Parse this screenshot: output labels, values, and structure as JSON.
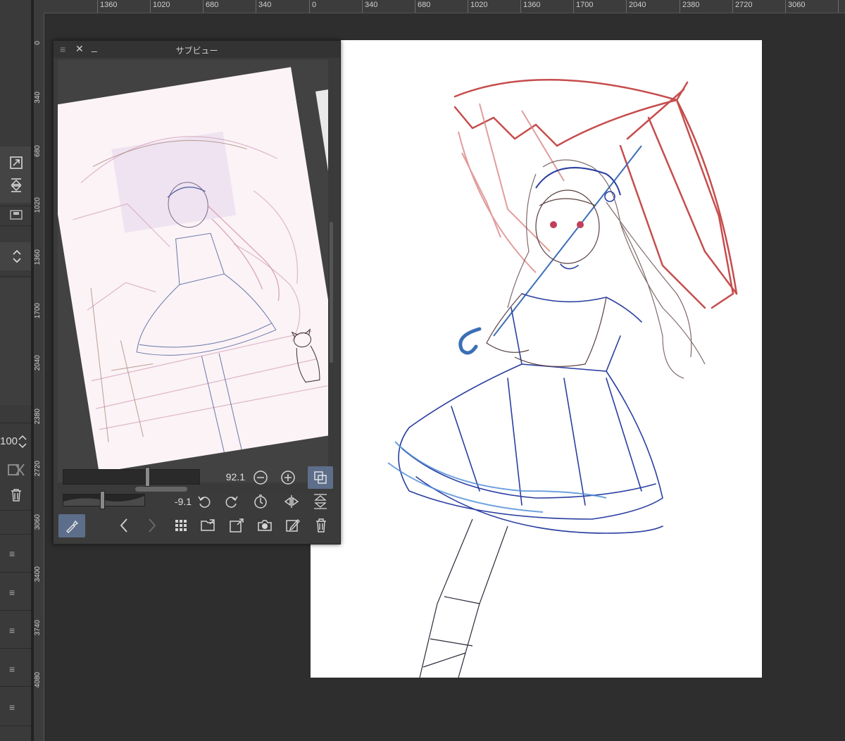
{
  "ruler_top": {
    "labels": [
      "1360",
      "1020",
      "680",
      "340",
      "0",
      "340",
      "680",
      "1020",
      "1360",
      "1700",
      "2040",
      "2380",
      "2720",
      "3060"
    ]
  },
  "ruler_left": {
    "labels": [
      "0",
      "340",
      "680",
      "1020",
      "1360",
      "1700",
      "2040",
      "2380",
      "2720",
      "3060",
      "3400",
      "3740",
      "4080"
    ]
  },
  "left_strip": {
    "value_field": "100"
  },
  "subview": {
    "title": "サブビュー",
    "zoom_value": "92.1",
    "rotation_value": "-9.1",
    "zoom_level": 0.62,
    "rotation_level": 0.48
  },
  "colors": {
    "panel": "#3b3b3b",
    "accent": "#5d6e8a",
    "umbrella": "#c03a3a",
    "dress": "#2a3fa0"
  }
}
